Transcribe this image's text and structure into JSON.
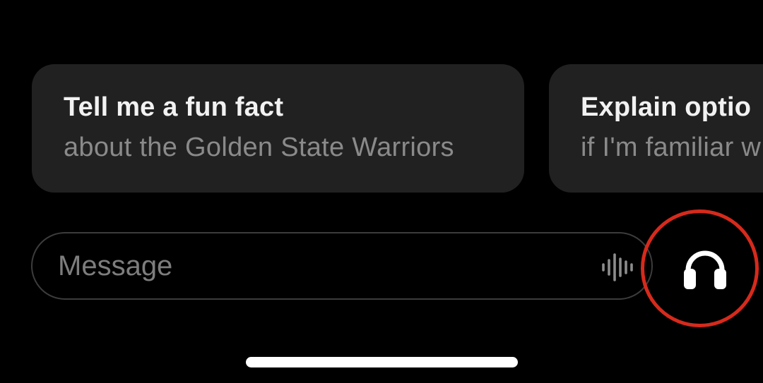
{
  "suggestions": [
    {
      "title": "Tell me a fun fact",
      "subtitle": "about the Golden State Warriors"
    },
    {
      "title": "Explain optio",
      "subtitle": "if I'm familiar w"
    }
  ],
  "composer": {
    "placeholder": "Message",
    "dictation_icon": "waveform-icon",
    "voice_icon": "headphones-icon"
  },
  "annotation": {
    "highlight_color": "#d62a1c",
    "highlighted_element": "voice-mode-button"
  },
  "colors": {
    "background": "#000000",
    "card_background": "#212121",
    "title_text": "#f2f2f2",
    "subtitle_text": "#8a8a8a",
    "input_border": "#3c3c3c"
  }
}
